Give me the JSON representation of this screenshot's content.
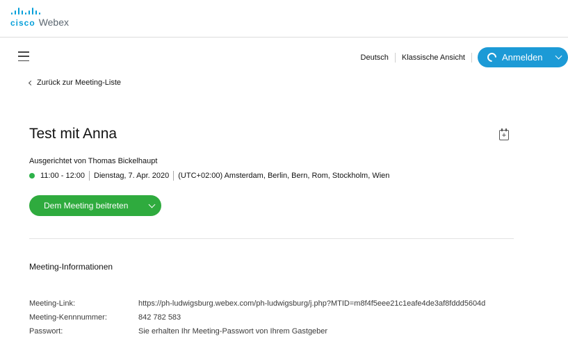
{
  "brand": {
    "cisco": "cisco",
    "product": "Webex",
    "color": "#049fd9"
  },
  "header": {
    "language": "Deutsch",
    "classic_view": "Klassische Ansicht",
    "sign_in": "Anmelden",
    "sign_in_color": "#1c9ad6"
  },
  "nav": {
    "back": "Zurück zur Meeting-Liste"
  },
  "meeting": {
    "title": "Test mit Anna",
    "host": "Ausgerichtet von Thomas Bickelhaupt",
    "time": "11:00 - 12:00",
    "date": "Dienstag, 7. Apr. 2020",
    "timezone": "(UTC+02:00) Amsterdam, Berlin, Bern, Rom, Stockholm, Wien",
    "status_color": "#2eb24a",
    "join_label": "Dem Meeting beitreten",
    "join_color": "#2fab3e"
  },
  "info": {
    "title": "Meeting-Informationen",
    "rows": [
      {
        "label": "Meeting-Link:",
        "value": "https://ph-ludwigsburg.webex.com/ph-ludwigsburg/j.php?MTID=m8f4f5eee21c1eafe4de3af8fddd5604d"
      },
      {
        "label": "Meeting-Kennnummer:",
        "value": "842 782 583"
      },
      {
        "label": "Passwort:",
        "value": "Sie erhalten Ihr Meeting-Passwort von Ihrem Gastgeber"
      }
    ]
  },
  "icons": [
    "cisco-logo-icon",
    "hamburger-menu-icon",
    "webex-icon",
    "chevron-down-icon",
    "chevron-left-icon",
    "add-to-calendar-icon",
    "status-dot-icon"
  ]
}
